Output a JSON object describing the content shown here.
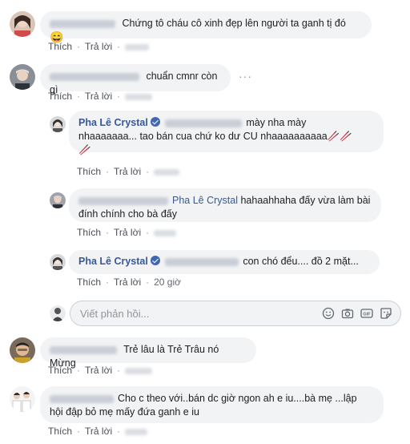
{
  "actions": {
    "like": "Thích",
    "reply": "Trả lời",
    "dot": "·"
  },
  "comments": [
    {
      "text": "Chứng tô cháu cô xinh đẹp lên người ta ganh tị đó",
      "emoji": "😄",
      "time": ""
    },
    {
      "text": "chuẩn cmnr còn gì",
      "time": ""
    },
    {
      "name": "Pha Lê Crystal",
      "line1": "mày nha mày",
      "line2": "nhaaaaaaa... tao bán cua chứ ko dư CU nhaaaaaaaaaa",
      "emoji_tail": "🥢🥢",
      "emoji_tail2": "🥢",
      "time": ""
    },
    {
      "tag": "Pha Lê Crystal",
      "line1": "hahaahhaha đấy vừa làm bài",
      "line2": "đính chính cho bà đấy",
      "time": ""
    },
    {
      "name": "Pha Lê Crystal",
      "text": "con chó đểu.... đồ 2 mặt...",
      "time": "20 giờ"
    },
    {
      "text": "Trẻ lâu là Trẻ Trâu nó Mừng",
      "time": ""
    },
    {
      "line1": "Cho c theo với..bán dc giờ ngon ah e iu....bà mẹ ...lập",
      "line2": "hội đập bỏ mẹ mấy đứa ganh e iu",
      "time": ""
    }
  ],
  "reply_box": {
    "placeholder": "Viết phản hồi..."
  },
  "icons": [
    "emoji-icon",
    "camera-icon",
    "gif-icon",
    "sticker-icon"
  ],
  "colors": {
    "link": "#385898",
    "bubble": "#f2f3f5",
    "verified": "#4267b2"
  }
}
